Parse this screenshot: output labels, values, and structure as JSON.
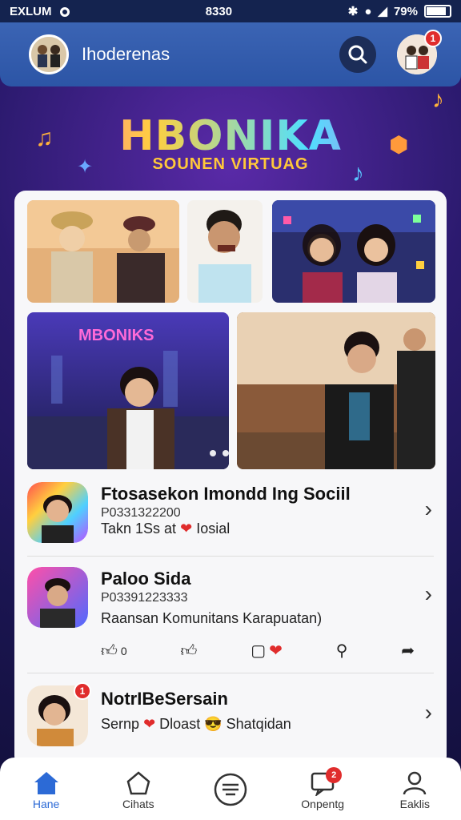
{
  "status_bar": {
    "carrier": "EXLUM",
    "time": "8330",
    "battery": "79%"
  },
  "header": {
    "title": "Ihoderenas",
    "notification_count": "1"
  },
  "banner": {
    "logo": "HBONIKA",
    "subtitle": "SOUNEN VIRTUAG",
    "thumb_logo": "MBONIKS"
  },
  "feed": [
    {
      "title": "Ftosasekon Imondd Ing Sociil",
      "code": "P0331322200",
      "desc_prefix": "Takn 1Ss at",
      "desc_suffix": "Iosial"
    },
    {
      "title": "Paloo Sida",
      "code": "P03391223333",
      "desc": "Raansan Komunitans Karapuatan)"
    },
    {
      "title": "NotrIBeSersain",
      "code_prefix": "Sernp",
      "code_mid": "Dloast",
      "code_suffix": "Shatqidan",
      "badge": "1"
    }
  ],
  "actions": [
    {
      "label": "0"
    },
    {
      "label": ""
    },
    {
      "label": ""
    },
    {
      "label": ""
    },
    {
      "label": ""
    }
  ],
  "bottom_nav": {
    "items": [
      {
        "label": "Hane"
      },
      {
        "label": "Cihats"
      },
      {
        "label": ""
      },
      {
        "label": "Onpentg",
        "badge": "2"
      },
      {
        "label": "Eaklis"
      }
    ]
  },
  "colors": {
    "accent": "#2c6ad6",
    "header": "#3b64b4",
    "badge": "#e02c2c"
  }
}
